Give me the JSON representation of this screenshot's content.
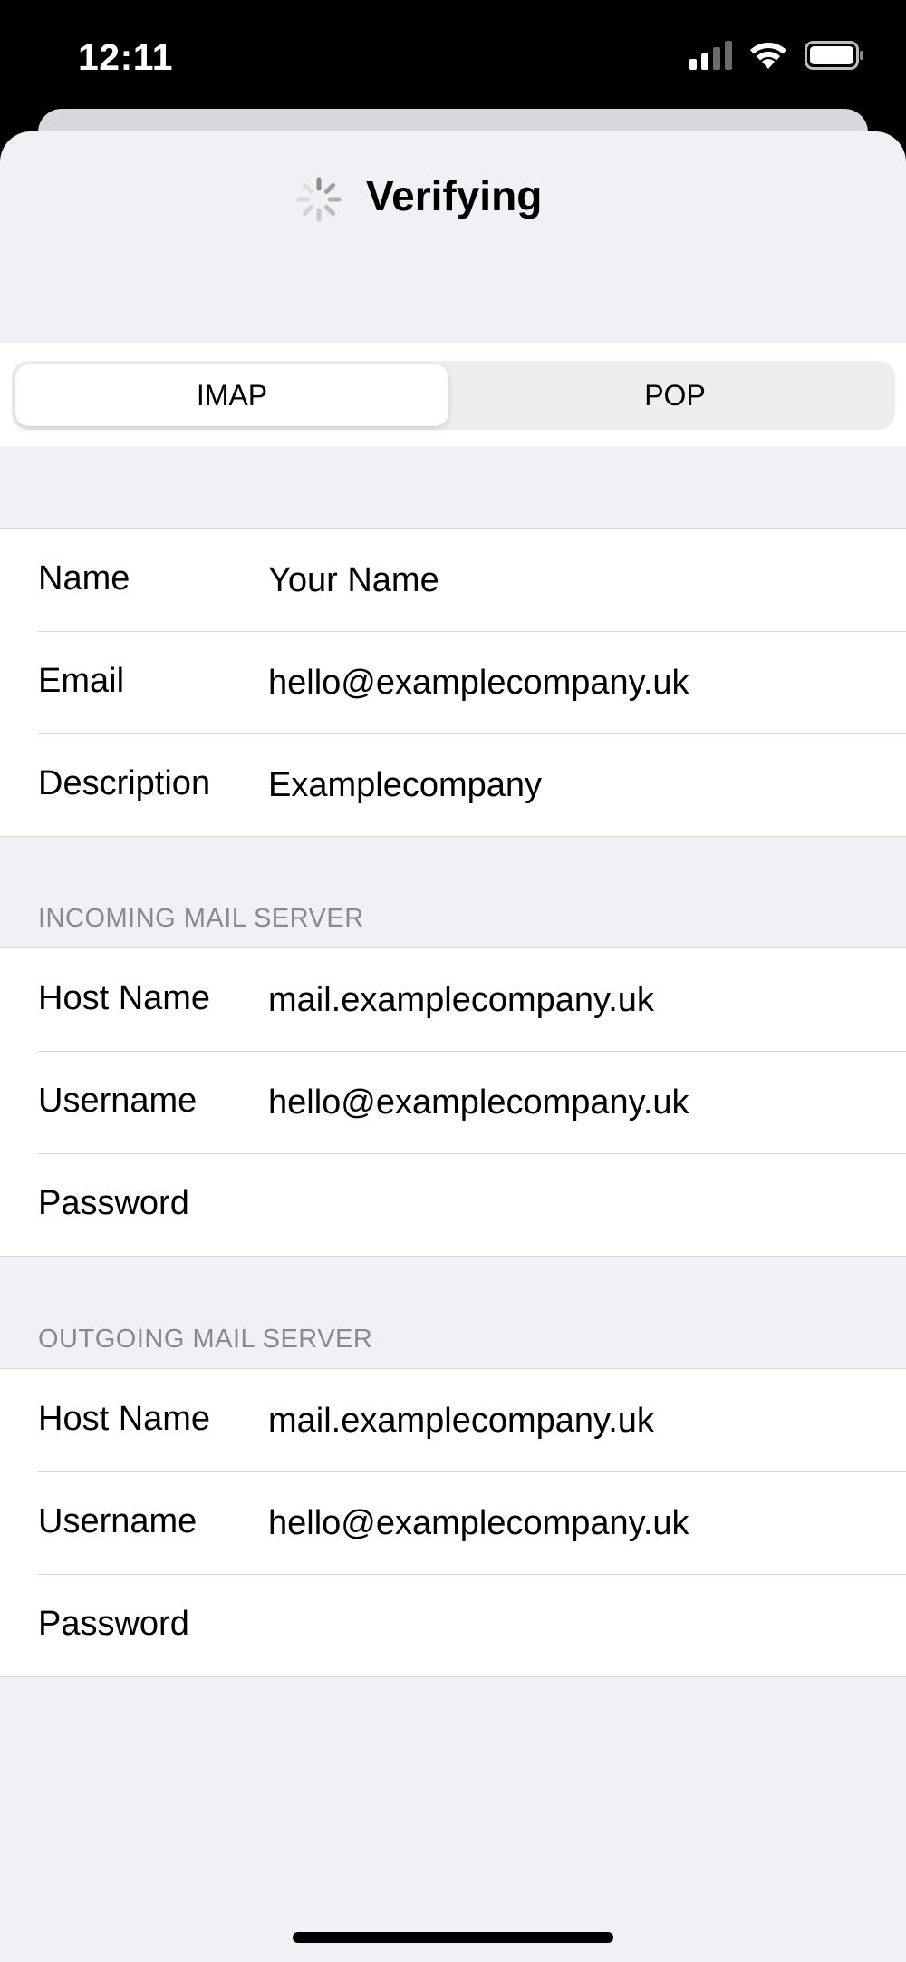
{
  "status_bar": {
    "time": "12:11",
    "icons": [
      "cellular-signal-icon",
      "wifi-icon",
      "battery-icon"
    ]
  },
  "nav": {
    "title": "Verifying",
    "spinner_icon": "activity-spinner-icon"
  },
  "segmented": {
    "options": [
      "IMAP",
      "POP"
    ],
    "selected": "IMAP"
  },
  "account": {
    "rows": [
      {
        "label": "Name",
        "value": "Your Name"
      },
      {
        "label": "Email",
        "value": "hello@examplecompany.uk"
      },
      {
        "label": "Description",
        "value": "Examplecompany"
      }
    ]
  },
  "incoming": {
    "header": "INCOMING MAIL SERVER",
    "rows": [
      {
        "label": "Host Name",
        "value": "mail.examplecompany.uk"
      },
      {
        "label": "Username",
        "value": "hello@examplecompany.uk"
      },
      {
        "label": "Password",
        "value": ""
      }
    ]
  },
  "outgoing": {
    "header": "OUTGOING MAIL SERVER",
    "rows": [
      {
        "label": "Host Name",
        "value": "mail.examplecompany.uk"
      },
      {
        "label": "Username",
        "value": "hello@examplecompany.uk"
      },
      {
        "label": "Password",
        "value": ""
      }
    ]
  },
  "colors": {
    "background": "#f0f0f5",
    "separator": "#d8d8dc",
    "section_header": "#8a8a8e"
  }
}
